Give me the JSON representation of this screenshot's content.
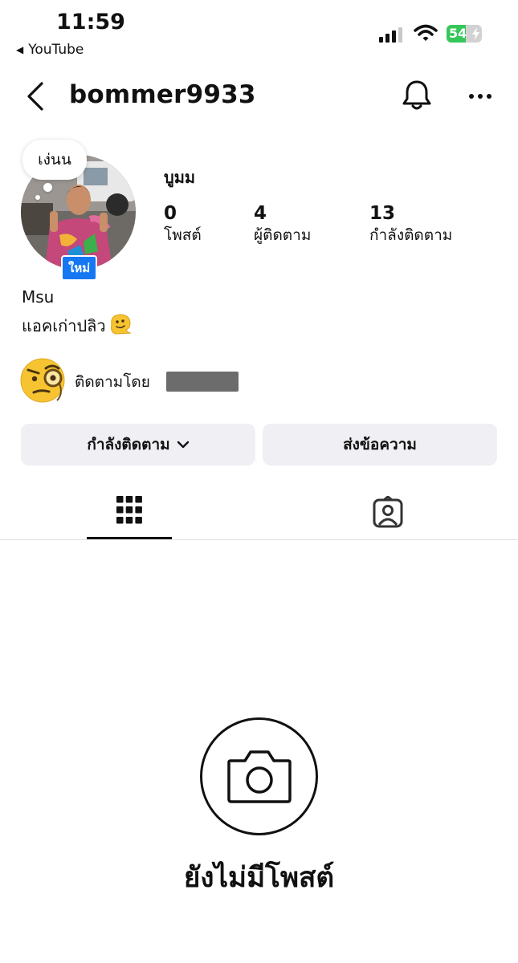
{
  "status_bar": {
    "time": "11:59",
    "back_app": "YouTube",
    "battery": "54",
    "battery_level": 0.54
  },
  "header": {
    "username": "bommer9933"
  },
  "profile": {
    "note": "เง่นน",
    "new_badge": "ใหม่",
    "full_name": "บูมม",
    "stats": [
      {
        "value": "0",
        "label": "โพสต์"
      },
      {
        "value": "4",
        "label": "ผู้ติดตาม"
      },
      {
        "value": "13",
        "label": "กำลังติดตาม"
      }
    ],
    "bio_line1": "Msu",
    "bio_line2": "แอคเก่าปลิว",
    "followed_by": "ติดตามโดย"
  },
  "actions": {
    "following_button": "กำลังติดตาม",
    "message_button": "ส่งข้อความ"
  },
  "tabs": [
    {
      "icon": "grid-icon",
      "active": true
    },
    {
      "icon": "tagged-person-icon",
      "active": false
    }
  ],
  "empty_state": {
    "icon": "camera-icon",
    "title": "ยังไม่มีโพสต์"
  }
}
